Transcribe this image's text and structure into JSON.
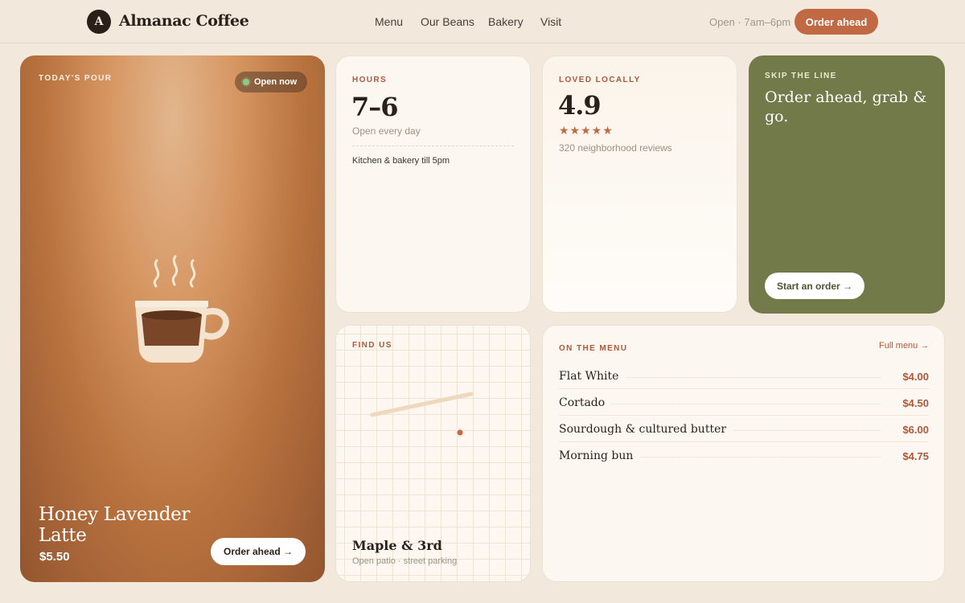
{
  "brand": {
    "mark": "A",
    "name": "Almanac Coffee"
  },
  "nav": {
    "items": [
      "Menu",
      "Our Beans",
      "Bakery",
      "Visit"
    ]
  },
  "header": {
    "hours": "Open · 7am–6pm",
    "order_btn": "Order ahead"
  },
  "hero": {
    "eyebrow": "TODAY'S POUR",
    "badge": "Open now",
    "title": "Honey Lavender Latte",
    "price": "$5.50",
    "button": "Order ahead →",
    "icon": "coffee-cup-icon"
  },
  "hours_card": {
    "eyebrow": "HOURS",
    "value": "7–6",
    "subtitle": "Open every day",
    "note": "Kitchen & bakery till 5pm"
  },
  "rating_card": {
    "eyebrow": "LOVED LOCALLY",
    "value": "4.9",
    "stars": "★★★★★",
    "star_count": 5,
    "reviews": "320 neighborhood reviews"
  },
  "skip_card": {
    "eyebrow": "SKIP THE LINE",
    "title": "Order ahead, grab & go.",
    "button": "Start an order →"
  },
  "map_card": {
    "eyebrow": "FIND US",
    "title": "Maple & 3rd",
    "subtitle": "Open patio · street parking"
  },
  "menu_card": {
    "eyebrow": "ON THE MENU",
    "link": "Full menu →",
    "items": [
      {
        "name": "Flat White",
        "price": "$4.00"
      },
      {
        "name": "Cortado",
        "price": "$4.50"
      },
      {
        "name": "Sourdough & cultured butter",
        "price": "$6.00"
      },
      {
        "name": "Morning bun",
        "price": "$4.75"
      }
    ]
  },
  "colors": {
    "background": "#f2e9dc",
    "accent": "#c16942",
    "dark": "#2a1f19",
    "olive": "#727a4a",
    "price": "#b0573a"
  }
}
